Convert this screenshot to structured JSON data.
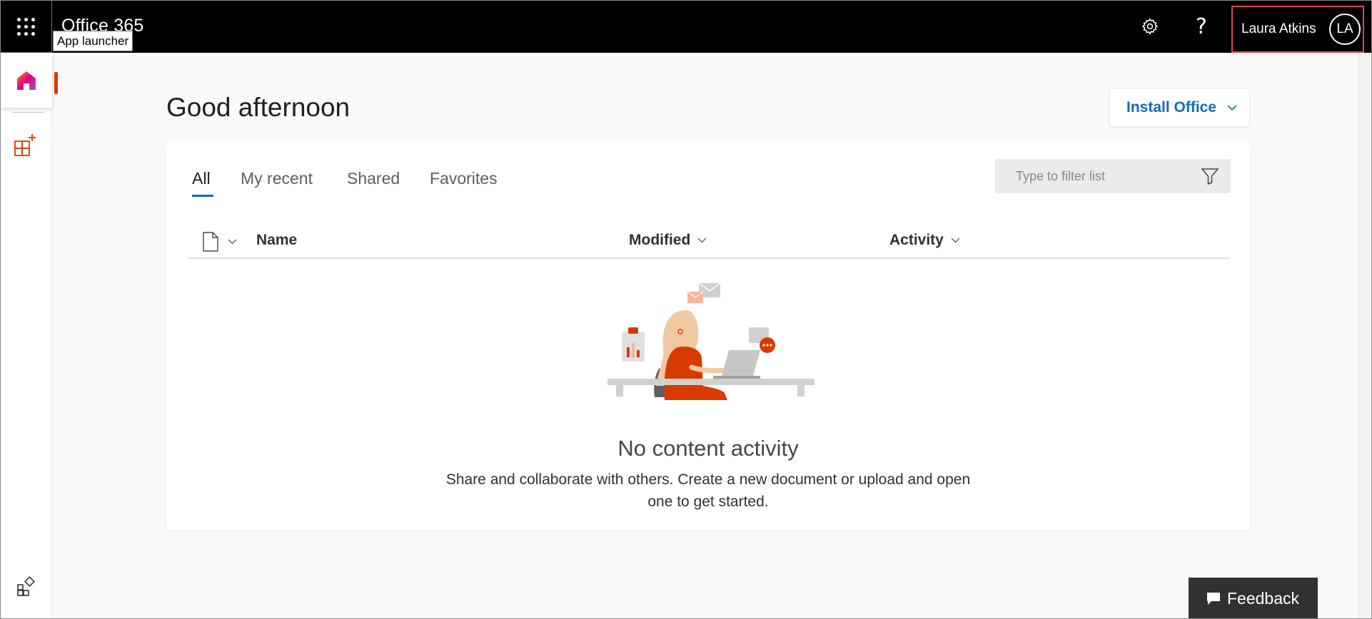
{
  "header": {
    "app_title": "Office 365",
    "waffle_tooltip": "App launcher",
    "waffle_icon": "waffle-icon",
    "settings_icon": "gear-icon",
    "help_label": "?",
    "account": {
      "name": "Laura Atkins",
      "initials": "LA"
    }
  },
  "rail": {
    "items": [
      {
        "id": "home",
        "icon": "home-icon",
        "active": true
      },
      {
        "id": "apps",
        "icon": "add-apps-icon",
        "active": false
      },
      {
        "id": "store",
        "icon": "app-store-icon",
        "active": false
      }
    ]
  },
  "main": {
    "greeting": "Good afternoon",
    "install_label": "Install Office",
    "tabs": [
      {
        "label": "All",
        "active": true
      },
      {
        "label": "My recent",
        "active": false
      },
      {
        "label": "Shared",
        "active": false
      },
      {
        "label": "Favorites",
        "active": false
      }
    ],
    "filter": {
      "placeholder": "Type to filter list",
      "value": ""
    },
    "columns": {
      "name": "Name",
      "modified": "Modified",
      "activity": "Activity"
    },
    "empty": {
      "title": "No content activity",
      "description": "Share and collaborate with others. Create a new document or upload and open one to get started."
    }
  },
  "feedback_label": "Feedback",
  "colors": {
    "topbar": "#000000",
    "accent": "#0f6cbd",
    "brand_orange": "#d83b01",
    "highlight_border": "#e0454f",
    "page_bg": "#faf9f8"
  }
}
